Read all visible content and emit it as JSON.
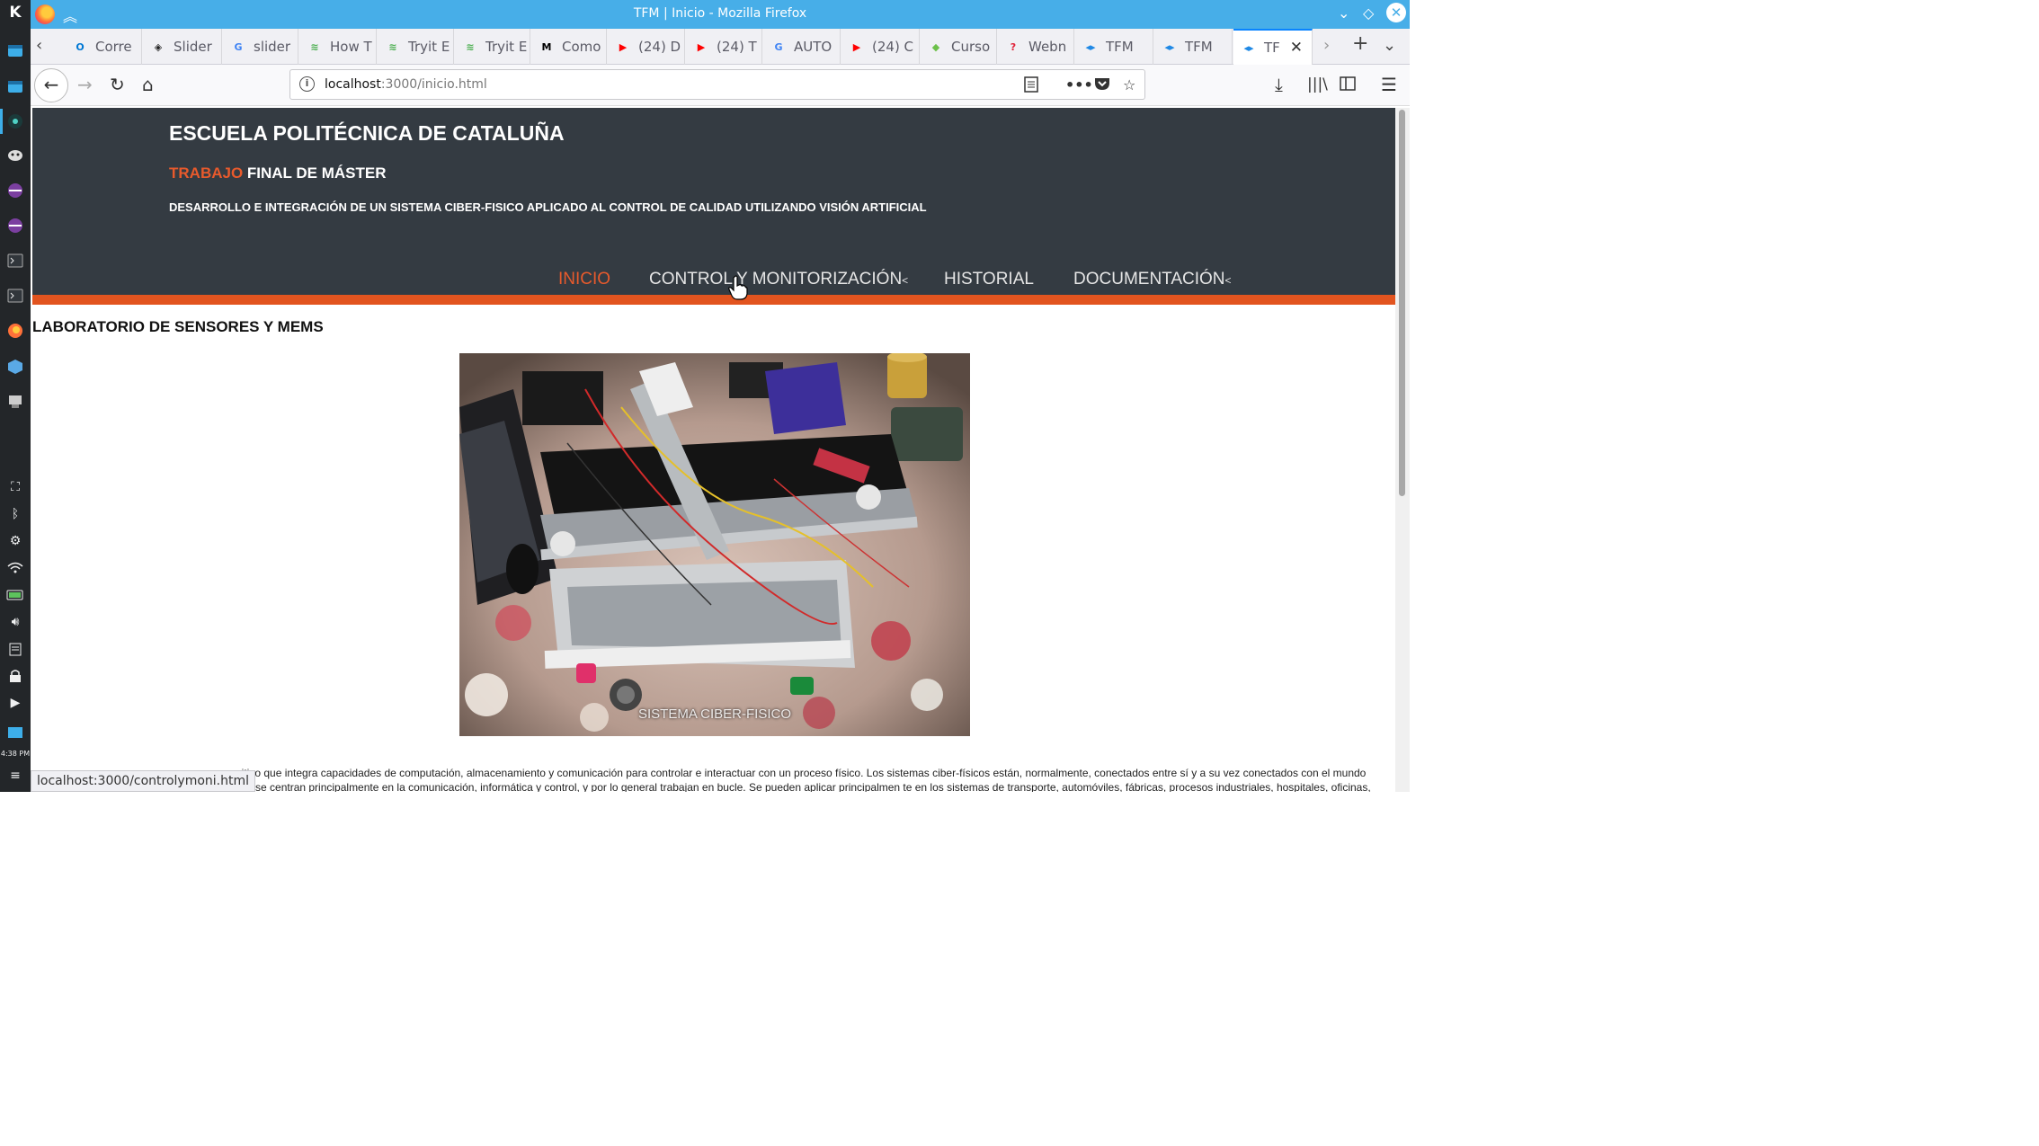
{
  "window": {
    "title": "TFM | Inicio - Mozilla Firefox"
  },
  "tabs": [
    {
      "label": "Corre",
      "icon": "outlook-icon",
      "color": "#0078d4",
      "glyph": "O"
    },
    {
      "label": "Slider",
      "icon": "codepen-icon",
      "color": "#222222",
      "glyph": "◈"
    },
    {
      "label": "slider",
      "icon": "google-icon",
      "color": "#4285f4",
      "glyph": "G"
    },
    {
      "label": "How T",
      "icon": "tryit-icon",
      "color": "#4caf50",
      "glyph": "≋"
    },
    {
      "label": "Tryit E",
      "icon": "tryit-icon",
      "color": "#4caf50",
      "glyph": "≋"
    },
    {
      "label": "Tryit E",
      "icon": "tryit-icon",
      "color": "#4caf50",
      "glyph": "≋"
    },
    {
      "label": "Como",
      "icon": "medium-icon",
      "color": "#000000",
      "glyph": "M"
    },
    {
      "label": "(24) D",
      "icon": "youtube-icon",
      "color": "#ff0000",
      "glyph": "▶"
    },
    {
      "label": "(24) T",
      "icon": "youtube-icon",
      "color": "#ff0000",
      "glyph": "▶"
    },
    {
      "label": "AUTO",
      "icon": "google-icon",
      "color": "#4285f4",
      "glyph": "G"
    },
    {
      "label": "(24) C",
      "icon": "youtube-icon",
      "color": "#ff0000",
      "glyph": "▶"
    },
    {
      "label": "Curso",
      "icon": "curso-icon",
      "color": "#6cc04a",
      "glyph": "◆"
    },
    {
      "label": "Webn",
      "icon": "webnode-icon",
      "color": "#e0243a",
      "glyph": "?"
    },
    {
      "label": "TFM",
      "icon": "tfm-icon",
      "color": "#1e88e5",
      "glyph": "◂▸"
    },
    {
      "label": "TFM",
      "icon": "tfm-icon",
      "color": "#1e88e5",
      "glyph": "◂▸"
    },
    {
      "label": "TF",
      "icon": "tfm-icon",
      "color": "#1e88e5",
      "glyph": "◂▸",
      "active": true
    }
  ],
  "navbar": {
    "url_host": "localhost",
    "url_path": ":3000/inicio.html"
  },
  "site": {
    "school": "ESCUELA POLITÉCNICA DE CATALUÑA",
    "tfm_accent": "TRABAJO",
    "tfm_rest": " FINAL DE MÁSTER",
    "project": "DESARROLLO E INTEGRACIÓN DE UN SISTEMA CIBER-FISICO APLICADO AL CONTROL DE CALIDAD UTILIZANDO VISIÓN ARTIFICIAL",
    "nav": [
      {
        "label": "INICIO",
        "active": true
      },
      {
        "label": "CONTROL Y MONITORIZACIÓN",
        "caret": "<"
      },
      {
        "label": "HISTORIAL"
      },
      {
        "label": "DOCUMENTACIÓN",
        "caret": "<"
      }
    ],
    "accent_color": "#e85a2c",
    "header_color": "#343b42"
  },
  "content": {
    "lab_title": "LABORATORIO DE SENSORES Y MEMS",
    "photo_caption": "SISTEMA CIBER-FISICO",
    "intro_line1": "ositivo que integra capacidades de computación, almacenamiento y comunicación para controlar e interactuar con un proceso físico. Los sistemas ciber-físicos están, normalmente, conectados entre sí y a su vez conectados con el mundo",
    "intro_line2": "CPS se centran principalmente en la comunicación, informática y control, y por lo general trabajan en bucle. Se pueden aplicar principalmen te en los sistemas de transporte, automóviles, fábricas, procesos industriales, hospitales, oficinas,"
  },
  "status": {
    "url": "localhost:3000/controlymoni.html"
  },
  "panel": {
    "clock": "4:38 PM"
  }
}
